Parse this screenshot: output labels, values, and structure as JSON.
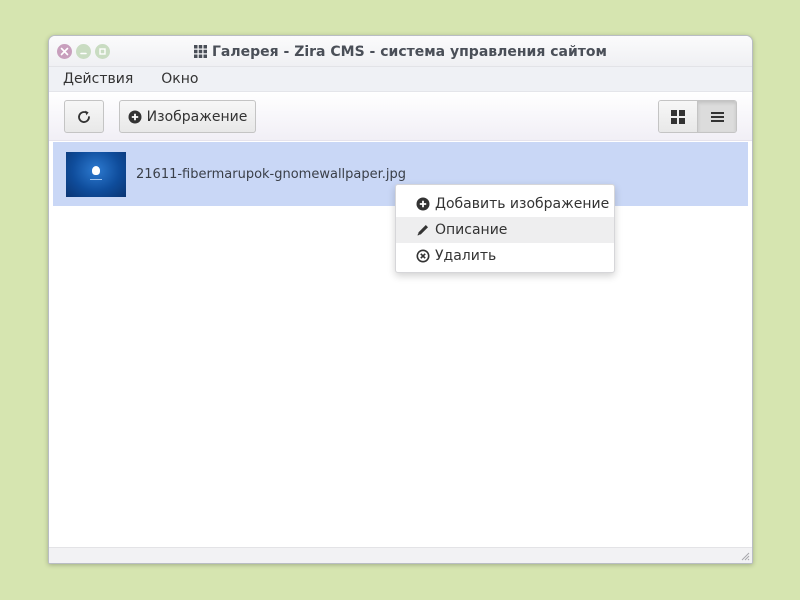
{
  "window": {
    "title": "Галерея - Zira CMS - система управления сайтом",
    "title_icon": "grid-icon",
    "controls": [
      "close-icon",
      "minimize-icon",
      "maximize-icon"
    ]
  },
  "menubar": {
    "items": [
      {
        "label": "Действия"
      },
      {
        "label": "Окно"
      }
    ]
  },
  "toolbar": {
    "refresh_icon": "refresh-icon",
    "add_image_label": "Изображение",
    "add_image_icon": "plus-circle-icon",
    "view_modes": [
      {
        "icon": "grid-view-icon",
        "active": false
      },
      {
        "icon": "list-view-icon",
        "active": true
      }
    ]
  },
  "files": [
    {
      "name": "21611-fibermarupok-gnomewallpaper.jpg",
      "selected": true
    }
  ],
  "context_menu": {
    "items": [
      {
        "label": "Добавить изображение",
        "icon": "plus-circle-icon"
      },
      {
        "label": "Описание",
        "icon": "pencil-icon",
        "hover": true
      },
      {
        "label": "Удалить",
        "icon": "x-circle-icon"
      }
    ]
  },
  "colors": {
    "desktop": "#d6e5b0",
    "selection": "#c9d7f6",
    "close_button": "#c89fbd",
    "window_buttons": "#c9dcc2"
  }
}
